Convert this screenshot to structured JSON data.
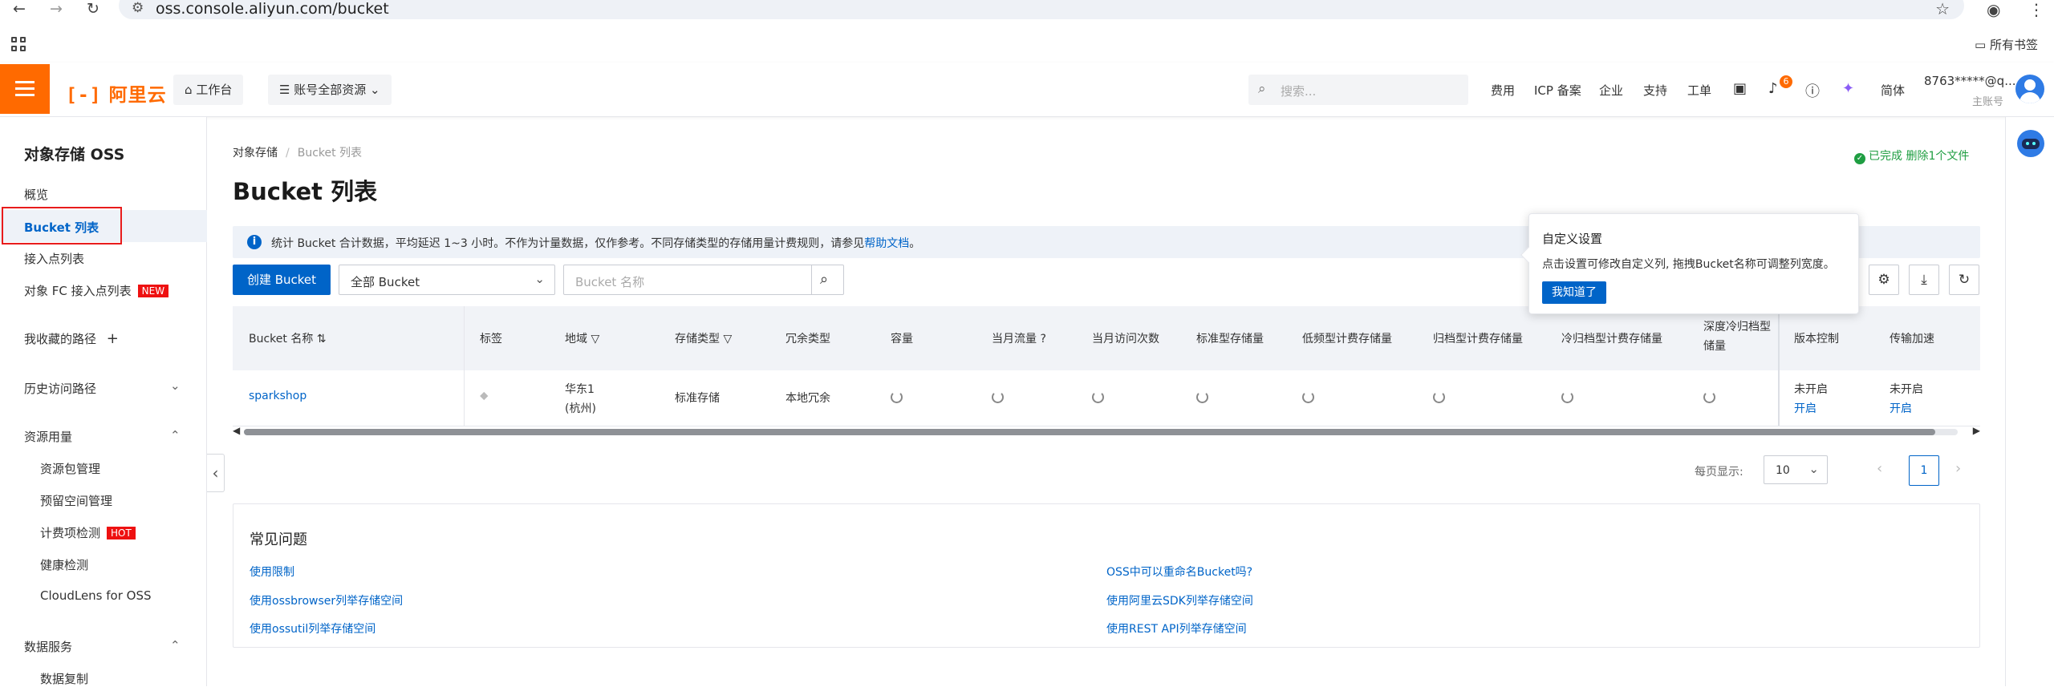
{
  "browser": {
    "url": "oss.console.aliyun.com/bucket",
    "bookmarks_folder": "所有书签"
  },
  "topbar": {
    "logo": "阿里云",
    "workbench": "工作台",
    "resources": "账号全部资源",
    "search_placeholder": "搜索...",
    "links": [
      "费用",
      "ICP 备案",
      "企业",
      "支持",
      "工单"
    ],
    "notification_count": "6",
    "language": "简体",
    "account_name": "8763*****@q...",
    "account_role": "主账号",
    "brand_color": "#ff6a00"
  },
  "sidebar": {
    "title": "对象存储 OSS",
    "items": [
      {
        "label": "概览"
      },
      {
        "label": "Bucket 列表",
        "active": true
      },
      {
        "label": "接入点列表"
      },
      {
        "label": "对象 FC 接入点列表",
        "tag": "NEW"
      },
      {
        "label": "我收藏的路径"
      },
      {
        "label": "历史访问路径"
      },
      {
        "label": "资源用量"
      }
    ],
    "resource_sub": [
      {
        "label": "资源包管理"
      },
      {
        "label": "预留空间管理"
      },
      {
        "label": "计费项检测",
        "tag": "HOT"
      },
      {
        "label": "健康检测"
      },
      {
        "label": "CloudLens for OSS"
      }
    ],
    "data_service": {
      "label": "数据服务"
    },
    "data_sub": [
      {
        "label": "数据复制"
      }
    ]
  },
  "main": {
    "breadcrumb": [
      "对象存储",
      "Bucket 列表"
    ],
    "title": "Bucket 列表",
    "task_status": "已完成 删除1个文件",
    "notice_text": "统计 Bucket 合计数据，平均延迟 1~3 小时。不作为计量数据，仅作参考。不同存储类型的存储用量计费规则，请参见",
    "notice_link": "帮助文档",
    "notice_end": "。",
    "create_button": "创建 Bucket",
    "filter_select": "全部 Bucket",
    "search_placeholder": "Bucket 名称",
    "accent_color": "#0064c8"
  },
  "popover": {
    "title": "自定义设置",
    "desc": "点击设置可修改自定义列, 拖拽Bucket名称可调整列宽度。",
    "ok": "我知道了"
  },
  "table": {
    "headers": {
      "name": "Bucket 名称",
      "tags": "标签",
      "region": "地域",
      "storage_class": "存储类型",
      "redundancy": "冗余类型",
      "capacity": "容量",
      "traffic": "当月流量",
      "requests": "当月访问次数",
      "standard": "标准型存储量",
      "ia": "低频型计费存储量",
      "archive": "归档型计费存储量",
      "cold": "冷归档型计费存储量",
      "deep_cold_1": "深度冷归档型",
      "deep_cold_2": "储量",
      "versioning": "版本控制",
      "acceleration": "传输加速"
    },
    "rows": [
      {
        "name": "sparkshop",
        "region_1": "华东1",
        "region_2": "(杭州)",
        "storage_class": "标准存储",
        "redundancy": "本地冗余",
        "versioning_status": "未开启",
        "versioning_action": "开启",
        "acceleration_status": "未开启",
        "acceleration_action": "开启"
      }
    ]
  },
  "pagination": {
    "label": "每页显示:",
    "page_size": "10",
    "current_page": "1"
  },
  "faq": {
    "title": "常见问题",
    "links": [
      "使用限制",
      "使用ossbrowser列举存储空间",
      "使用ossutil列举存储空间",
      "OSS中可以重命名Bucket吗?",
      "使用阿里云SDK列举存储空间",
      "使用REST API列举存储空间"
    ]
  }
}
